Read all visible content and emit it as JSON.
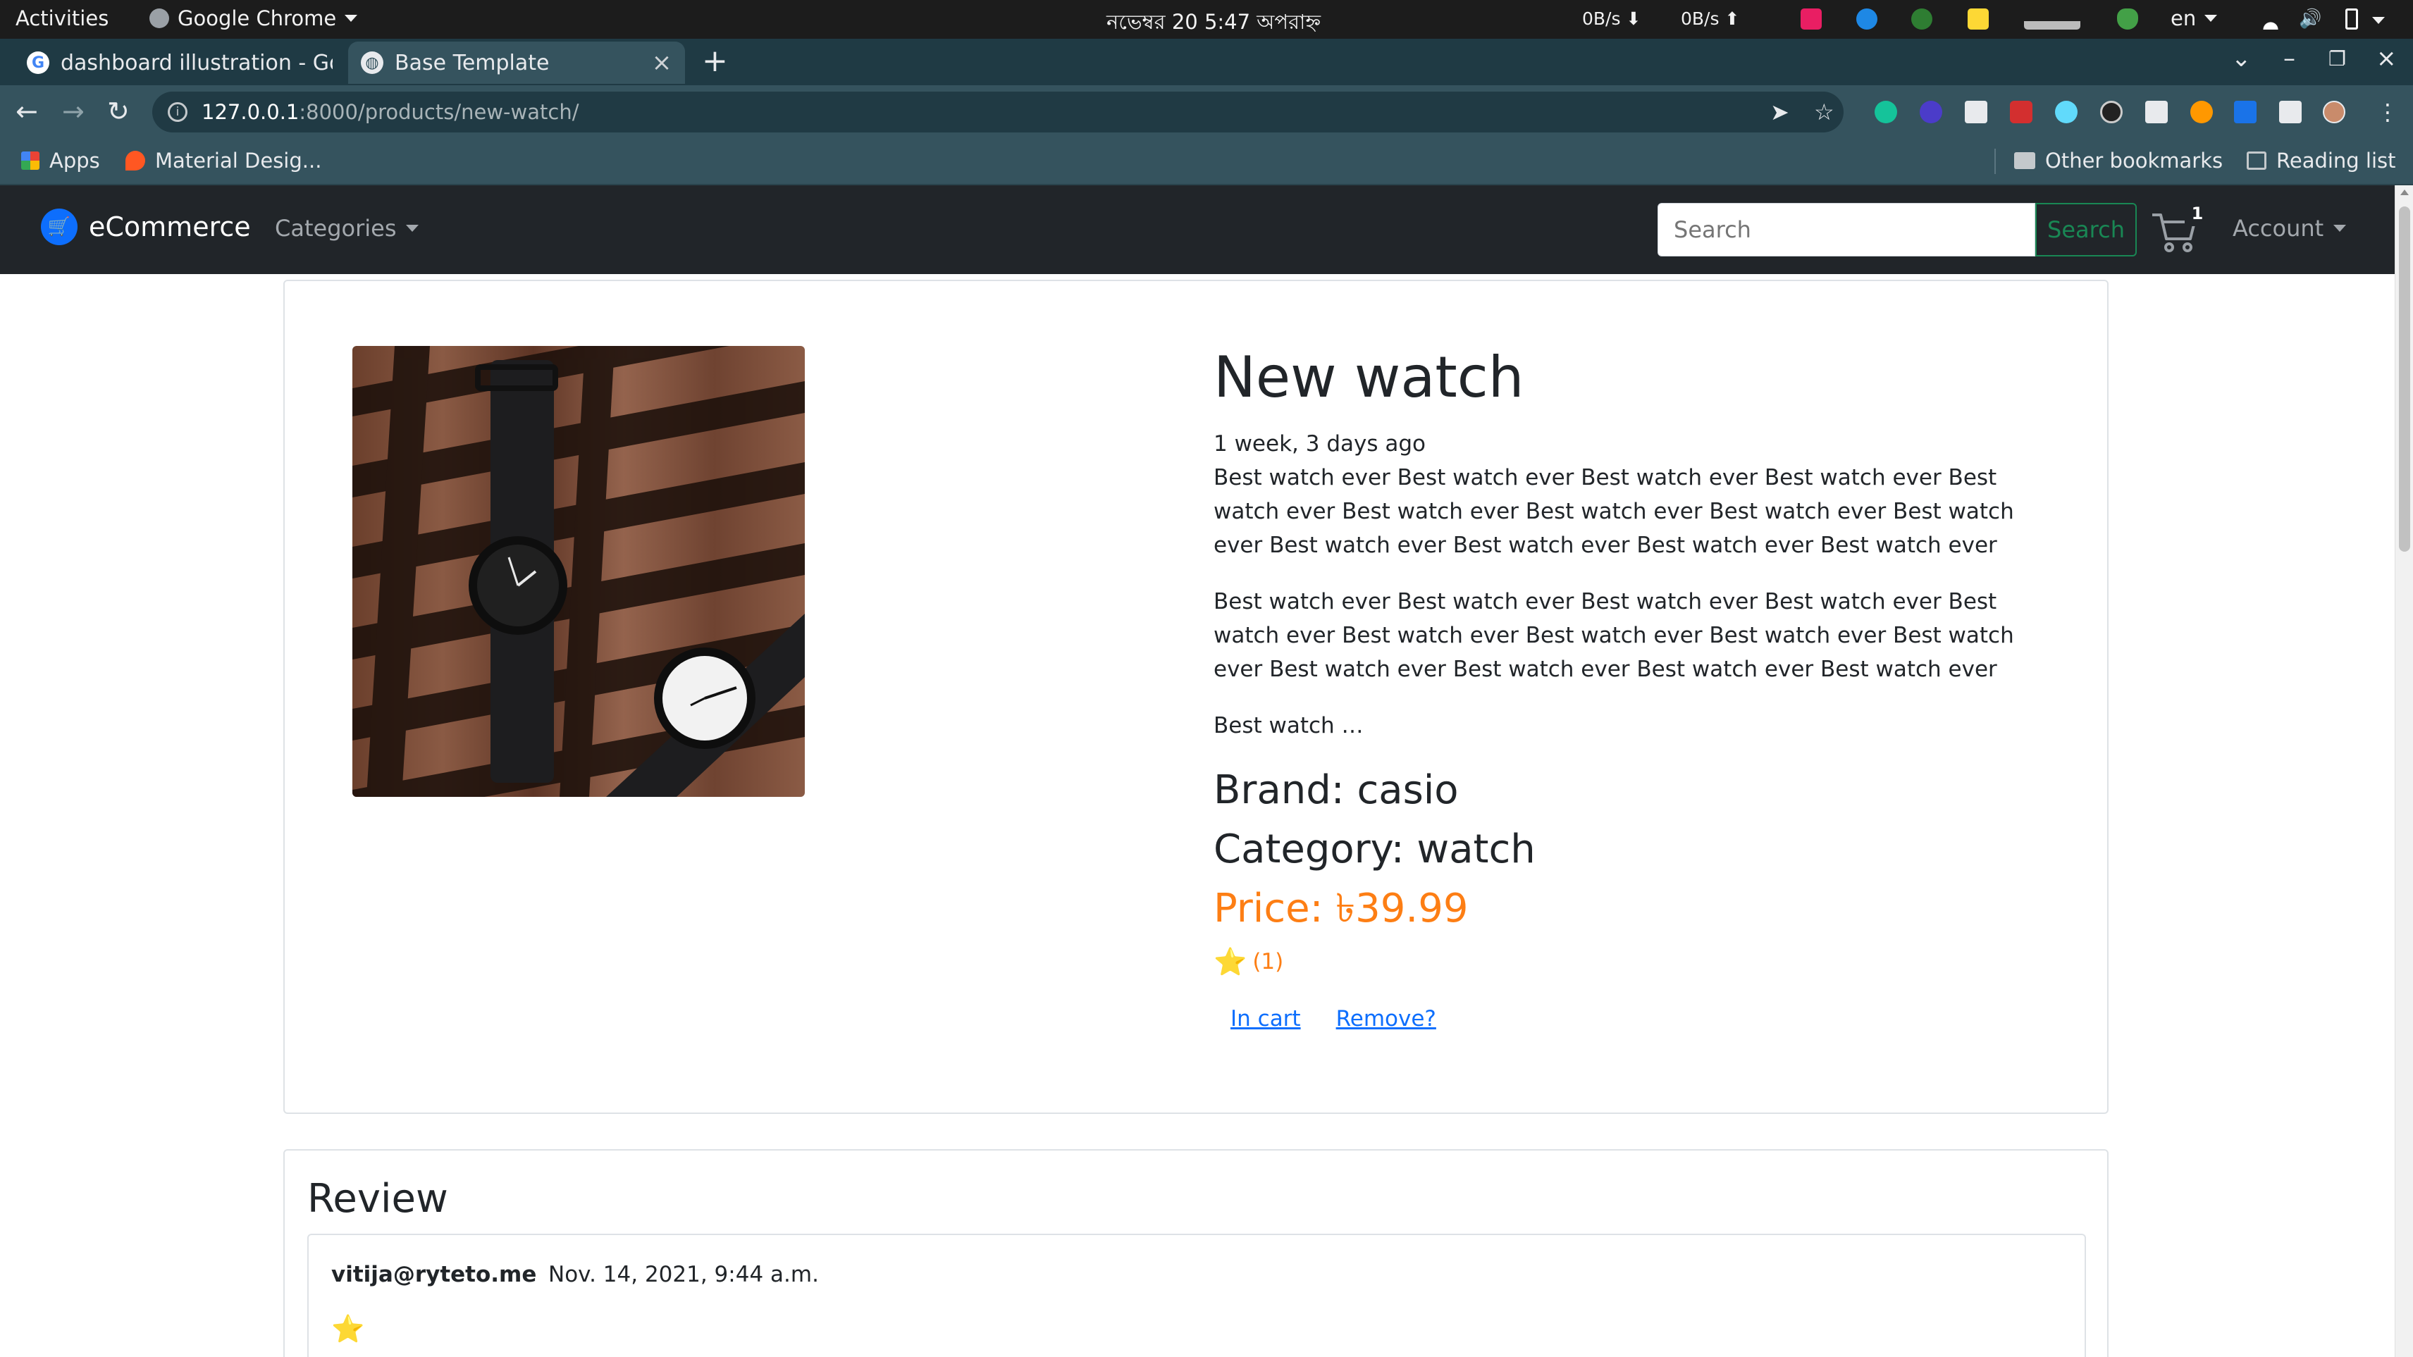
{
  "os_bar": {
    "activities": "Activities",
    "app_name": "Google Chrome",
    "clock": "নভেম্বর 20  5:47 অপরাহ্ন",
    "net_down": "0B/s",
    "net_up": "0B/s",
    "language": "en"
  },
  "browser": {
    "tabs": [
      {
        "title": "dashboard illustration - Google Search",
        "active": false,
        "icon": "google-icon"
      },
      {
        "title": "Base Template",
        "active": true,
        "icon": "globe-icon"
      }
    ],
    "url_host": "127.0.0.1",
    "url_path": ":8000/products/new-watch/",
    "bookmarks": [
      {
        "label": "Apps",
        "icon": "apps-grid-icon"
      },
      {
        "label": "Material Desig...",
        "icon": "material-design-icon"
      }
    ],
    "other_bookmarks": "Other bookmarks",
    "reading_list": "Reading list"
  },
  "site": {
    "brand": "eCommerce",
    "nav": {
      "categories": "Categories",
      "account": "Account"
    },
    "search": {
      "placeholder": "Search",
      "button": "Search"
    },
    "cart_count": "1"
  },
  "product": {
    "title": "New watch",
    "posted": "1 week, 3 days ago",
    "description_1": "Best watch ever Best watch ever Best watch ever Best watch ever Best watch ever Best watch ever Best watch ever Best watch ever Best watch ever Best watch ever Best watch ever Best watch ever Best watch ever",
    "description_2": "Best watch ever Best watch ever Best watch ever Best watch ever Best watch ever Best watch ever Best watch ever Best watch ever Best watch ever Best watch ever Best watch ever Best watch ever Best watch ever",
    "description_short": "Best watch …",
    "brand_line": "Brand: casio",
    "category_line": "Category: watch",
    "price_line": "Price: ৳39.99",
    "rating_star": "⭐",
    "rating_count": "(1)",
    "in_cart_link": "In cart",
    "remove_link": "Remove?"
  },
  "review": {
    "heading": "Review",
    "items": [
      {
        "user": "vitija@ryteto.me",
        "date": "Nov. 14, 2021, 9:44 a.m.",
        "stars": "⭐"
      }
    ]
  },
  "colors": {
    "navbar_bg": "#212529",
    "price": "#fd7e14",
    "link": "#0d6efd",
    "search_button": "#198754",
    "chrome_frame": "#35535e"
  }
}
